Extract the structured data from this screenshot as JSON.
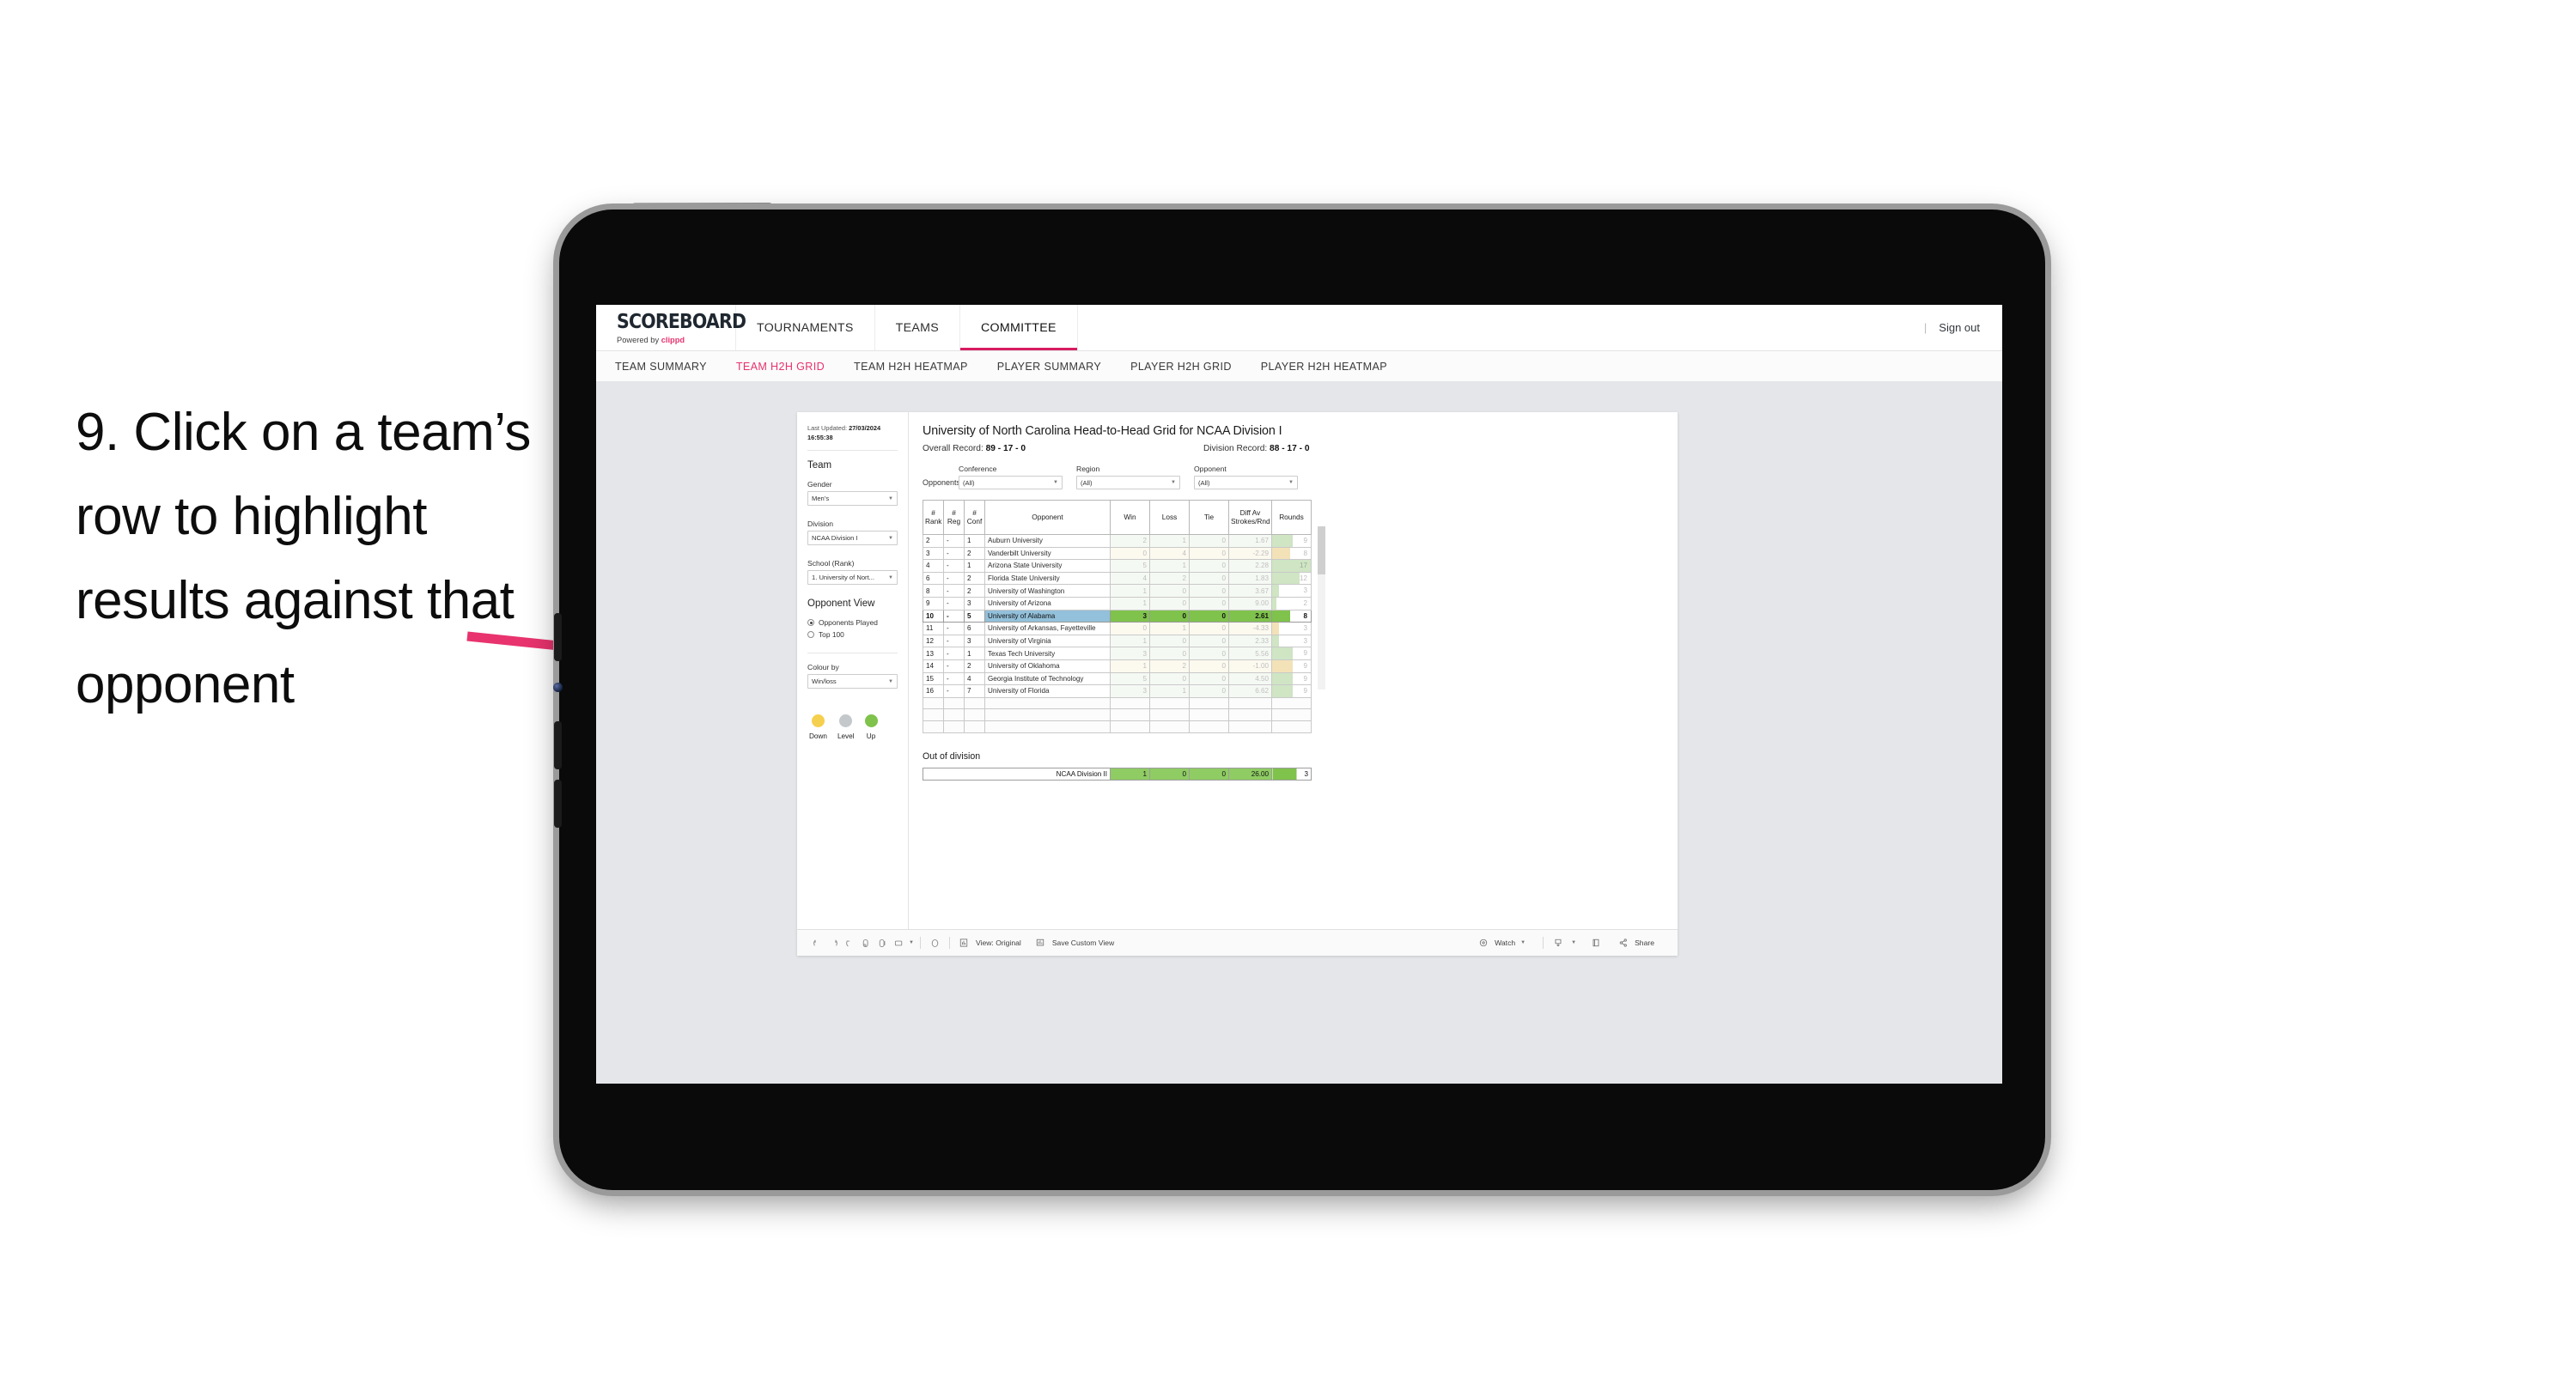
{
  "annotation": {
    "text": "9. Click on a team’s row to highlight results against that opponent",
    "arrow_color": "#e8336e"
  },
  "app": {
    "brand": {
      "title": "SCOREBOARD",
      "powered_prefix": "Powered by ",
      "powered_name": "clippd"
    },
    "top_nav": [
      {
        "label": "TOURNAMENTS",
        "active": false
      },
      {
        "label": "TEAMS",
        "active": false
      },
      {
        "label": "COMMITTEE",
        "active": true
      }
    ],
    "sign_out": "Sign out",
    "divider": "|",
    "sub_nav": [
      {
        "label": "TEAM SUMMARY",
        "active": false
      },
      {
        "label": "TEAM H2H GRID",
        "active": true
      },
      {
        "label": "TEAM H2H HEATMAP",
        "active": false
      },
      {
        "label": "PLAYER SUMMARY",
        "active": false
      },
      {
        "label": "PLAYER H2H GRID",
        "active": false
      },
      {
        "label": "PLAYER H2H HEATMAP",
        "active": false
      }
    ],
    "accent_color": "#e8336e"
  },
  "sidebar": {
    "last_updated_label": "Last Updated: ",
    "last_updated_value": "27/03/2024 16:55:38",
    "team_heading": "Team",
    "gender": {
      "label": "Gender",
      "value": "Men’s"
    },
    "division": {
      "label": "Division",
      "value": "NCAA Division I"
    },
    "school": {
      "label": "School (Rank)",
      "value": "1. University of Nort..."
    },
    "opponent_view": {
      "heading": "Opponent View",
      "options": [
        {
          "label": "Opponents Played",
          "selected": true
        },
        {
          "label": "Top 100",
          "selected": false
        }
      ]
    },
    "colour_by": {
      "label": "Colour by",
      "value": "Win/loss"
    },
    "legend": [
      {
        "label": "Down",
        "color": "#f5d04e"
      },
      {
        "label": "Level",
        "color": "#c4c8cb"
      },
      {
        "label": "Up",
        "color": "#7fc24c"
      }
    ]
  },
  "main": {
    "title": "University of North Carolina Head-to-Head Grid for NCAA Division I",
    "overall_record_label": "Overall Record: ",
    "overall_record_value": "89 - 17 - 0",
    "division_record_label": "Division Record: ",
    "division_record_value": "88 - 17 - 0",
    "opponents_label": "Opponents:",
    "filters": [
      {
        "label": "Conference",
        "value": "(All)"
      },
      {
        "label": "Region",
        "value": "(All)"
      },
      {
        "label": "Opponent",
        "value": "(All)"
      }
    ],
    "columns": [
      "# Rank",
      "# Reg",
      "# Conf",
      "Opponent",
      "Win",
      "Loss",
      "Tie",
      "Diff Av Strokes/Rnd",
      "Rounds"
    ],
    "column_lines": [
      [
        "#",
        "Rank"
      ],
      [
        "#",
        "Reg"
      ],
      [
        "#",
        "Conf"
      ],
      [
        "Opponent"
      ],
      [
        "Win"
      ],
      [
        "Loss"
      ],
      [
        "Tie"
      ],
      [
        "Diff Av",
        "Strokes/Rnd"
      ],
      [
        "Rounds"
      ]
    ],
    "rows": [
      {
        "rank": "2",
        "reg": "-",
        "conf": "1",
        "opponent": "Auburn University",
        "win": "2",
        "loss": "1",
        "tie": "0",
        "diff": "1.67",
        "rounds": "9",
        "tone": "up",
        "selected": false
      },
      {
        "rank": "3",
        "reg": "-",
        "conf": "2",
        "opponent": "Vanderbilt University",
        "win": "0",
        "loss": "4",
        "tie": "0",
        "diff": "-2.29",
        "rounds": "8",
        "tone": "down",
        "selected": false
      },
      {
        "rank": "4",
        "reg": "-",
        "conf": "1",
        "opponent": "Arizona State University",
        "win": "5",
        "loss": "1",
        "tie": "0",
        "diff": "2.28",
        "rounds": "17",
        "tone": "up",
        "selected": false
      },
      {
        "rank": "6",
        "reg": "-",
        "conf": "2",
        "opponent": "Florida State University",
        "win": "4",
        "loss": "2",
        "tie": "0",
        "diff": "1.83",
        "rounds": "12",
        "tone": "up",
        "selected": false
      },
      {
        "rank": "8",
        "reg": "-",
        "conf": "2",
        "opponent": "University of Washington",
        "win": "1",
        "loss": "0",
        "tie": "0",
        "diff": "3.67",
        "rounds": "3",
        "tone": "up",
        "selected": false
      },
      {
        "rank": "9",
        "reg": "-",
        "conf": "3",
        "opponent": "University of Arizona",
        "win": "1",
        "loss": "0",
        "tie": "0",
        "diff": "9.00",
        "rounds": "2",
        "tone": "up",
        "selected": false
      },
      {
        "rank": "10",
        "reg": "-",
        "conf": "5",
        "opponent": "University of Alabama",
        "win": "3",
        "loss": "0",
        "tie": "0",
        "diff": "2.61",
        "rounds": "8",
        "tone": "up",
        "selected": true
      },
      {
        "rank": "11",
        "reg": "-",
        "conf": "6",
        "opponent": "University of Arkansas, Fayetteville",
        "win": "0",
        "loss": "1",
        "tie": "0",
        "diff": "-4.33",
        "rounds": "3",
        "tone": "down",
        "selected": false
      },
      {
        "rank": "12",
        "reg": "-",
        "conf": "3",
        "opponent": "University of Virginia",
        "win": "1",
        "loss": "0",
        "tie": "0",
        "diff": "2.33",
        "rounds": "3",
        "tone": "up",
        "selected": false
      },
      {
        "rank": "13",
        "reg": "-",
        "conf": "1",
        "opponent": "Texas Tech University",
        "win": "3",
        "loss": "0",
        "tie": "0",
        "diff": "5.56",
        "rounds": "9",
        "tone": "up",
        "selected": false
      },
      {
        "rank": "14",
        "reg": "-",
        "conf": "2",
        "opponent": "University of Oklahoma",
        "win": "1",
        "loss": "2",
        "tie": "0",
        "diff": "-1.00",
        "rounds": "9",
        "tone": "down",
        "selected": false
      },
      {
        "rank": "15",
        "reg": "-",
        "conf": "4",
        "opponent": "Georgia Institute of Technology",
        "win": "5",
        "loss": "0",
        "tie": "0",
        "diff": "4.50",
        "rounds": "9",
        "tone": "up",
        "selected": false
      },
      {
        "rank": "16",
        "reg": "-",
        "conf": "7",
        "opponent": "University of Florida",
        "win": "3",
        "loss": "1",
        "tie": "0",
        "diff": "6.62",
        "rounds": "9",
        "tone": "up",
        "selected": false
      }
    ],
    "out_of_division": {
      "title": "Out of division",
      "rows": [
        {
          "name": "NCAA Division II",
          "win": "1",
          "loss": "0",
          "tie": "0",
          "diff": "26.00",
          "rounds": "3"
        }
      ]
    }
  },
  "toolbar": {
    "icons": [
      "undo-icon",
      "redo-icon",
      "revert-icon",
      "refresh-icon",
      "pause-icon",
      "rectangle-select-icon"
    ],
    "items": [
      {
        "icon": "view-original-icon",
        "label": "View: Original"
      },
      {
        "icon": "save-custom-view-icon",
        "label": "Save Custom View"
      },
      {
        "icon": "watch-icon",
        "label": "Watch"
      },
      {
        "icon": "download-icon",
        "label": ""
      },
      {
        "icon": "fullscreen-icon",
        "label": ""
      },
      {
        "icon": "share-icon",
        "label": "Share"
      }
    ],
    "view_original": "View: Original",
    "save_custom_view": "Save Custom View",
    "watch": "Watch",
    "share": "Share"
  },
  "colors": {
    "tone_up_bg": "#dfeeda",
    "tone_down_bg": "#f8eccd",
    "selected_row_bg": "#7fc24c",
    "selected_opp_bg": "#93c0da",
    "bar_up": "#cfe5c4",
    "bar_down": "#f3e2b8"
  }
}
